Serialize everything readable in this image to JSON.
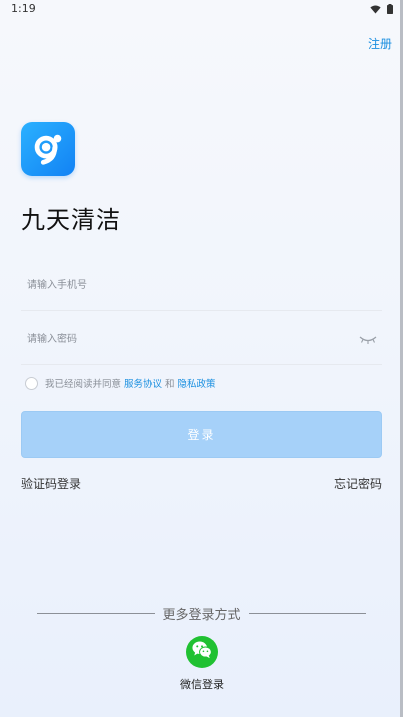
{
  "status_bar": {
    "time": "1:19",
    "icons": [
      "wifi-icon",
      "battery-icon"
    ]
  },
  "header": {
    "register_label": "注册"
  },
  "brand": {
    "logo_icon": "app-logo-icon",
    "app_name": "九天清洁",
    "accent_color": "#1a8fe0"
  },
  "form": {
    "phone_placeholder": "请输入手机号",
    "phone_value": "",
    "password_placeholder": "请输入密码",
    "password_value": "",
    "password_toggle_icon": "eye-closed-icon"
  },
  "agreement": {
    "checked": false,
    "prefix": "我已经阅读并同意",
    "service_link": "服务协议",
    "joiner": "和",
    "privacy_link": "隐私政策"
  },
  "login_button": {
    "label": "登录",
    "color": "#a6d1f9"
  },
  "links": {
    "sms_login": "验证码登录",
    "forgot_password": "忘记密码"
  },
  "more_login": {
    "title": "更多登录方式",
    "wechat_label": "微信登录",
    "wechat_icon": "wechat-icon",
    "wechat_color": "#20c132"
  }
}
